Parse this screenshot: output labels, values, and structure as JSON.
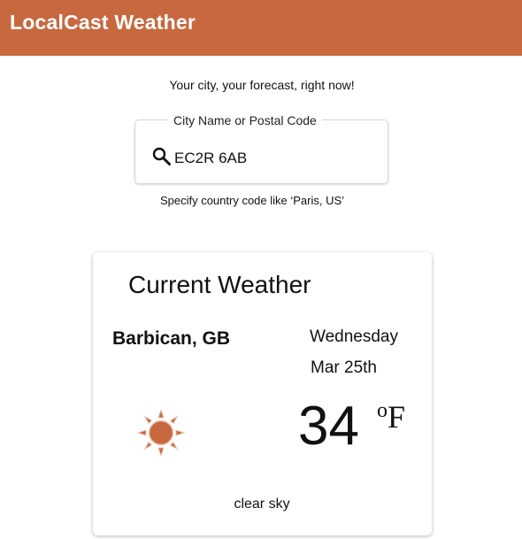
{
  "header": {
    "app_title": "LocalCast Weather",
    "background_color": "#c8683f"
  },
  "search": {
    "tagline": "Your city, your forecast, right now!",
    "legend": "City Name or Postal Code",
    "value": "EC2R 6AB",
    "placeholder": "",
    "helper_text": "Specify country code like ‘Paris, US’",
    "icon": "search-icon"
  },
  "weather_card": {
    "title": "Current Weather",
    "location": "Barbican, GB",
    "day": "Wednesday",
    "date": "Mar 25th",
    "temperature": "34",
    "unit_degree": "o",
    "unit_letter": "F",
    "condition": "clear sky",
    "icon": "sun-icon",
    "icon_color": "#c8683f"
  }
}
